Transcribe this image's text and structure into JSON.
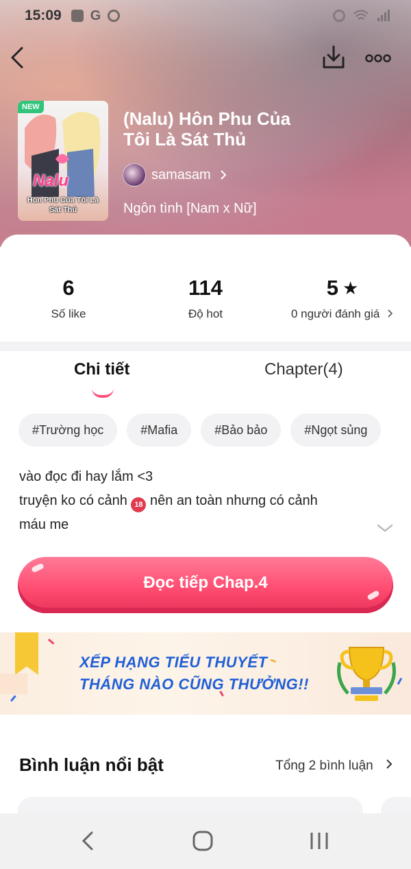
{
  "status_bar": {
    "time": "15:09"
  },
  "hero": {
    "cover": {
      "badge": "NEW",
      "logo_text": "Nalu",
      "subtitle": "Hôn Phu Của Tôi Là Sát Thủ"
    },
    "title_line1": "(Nalu) Hôn Phu Của",
    "title_line2": "Tôi Là Sát Thủ",
    "author": "samasam",
    "genre": "Ngôn tình [Nam x Nữ]"
  },
  "stats": [
    {
      "value": "6",
      "label": "Số like"
    },
    {
      "value": "114",
      "label": "Độ hot"
    },
    {
      "value": "5",
      "label": "0 người đánh giá"
    }
  ],
  "tabs": {
    "detail": "Chi tiết",
    "chapter": "Chapter(4)"
  },
  "tags": [
    "#Trường học",
    "#Mafia",
    "#Bảo bảo",
    "#Ngọt sủng"
  ],
  "description": {
    "line1": "vào đọc đi hay lắm <3",
    "line2_before": "truyện ko có cảnh ",
    "line2_badge": "18",
    "line2_after": " nên an toàn nhưng có  cảnh",
    "line3": "máu me"
  },
  "read_button": "Đọc tiếp Chap.4",
  "banner": {
    "line1": "XẾP HẠNG TIỂU THUYẾT",
    "line2": "THÁNG NÀO CŨNG THƯỞNG!!"
  },
  "comments": {
    "title": "Bình luận nổi bật",
    "count_label": "Tổng 2 bình luận"
  },
  "colors": {
    "accent": "#ff4d78",
    "banner_text": "#1f5fd6"
  }
}
